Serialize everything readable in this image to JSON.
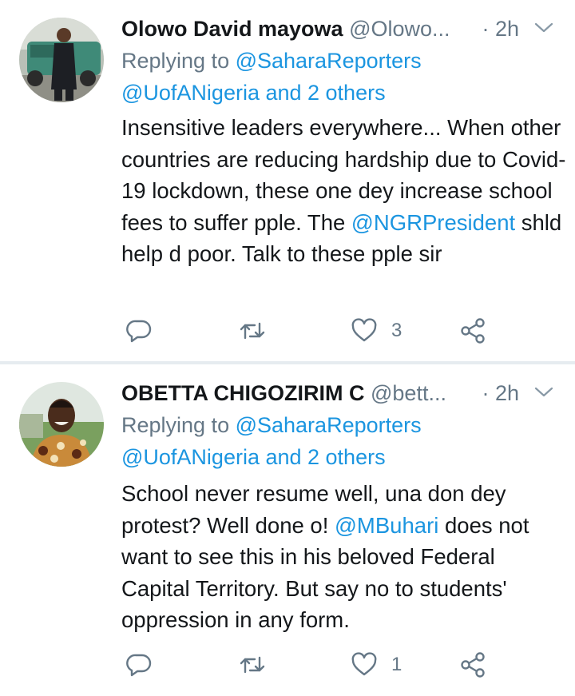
{
  "tweets": [
    {
      "name": "Olowo David mayowa",
      "handle": "@Olowo...",
      "time": "· 2h",
      "replying_prefix": "Replying to ",
      "replying_to": "@SaharaReporters",
      "replying_line2": "@UofANigeria and 2 others",
      "body_parts": [
        "Insensitive leaders everywhere... When other countries are reducing hardship due to Covid-19 lockdown, these one dey increase school fees to suffer pple. The ",
        "@NGRPresident",
        " shld help d poor. Talk to these pple sir"
      ],
      "likes": "3"
    },
    {
      "name": "OBETTA CHIGOZIRIM C",
      "handle": "@bett...",
      "time": "· 2h",
      "replying_prefix": "Replying to ",
      "replying_to": "@SaharaReporters",
      "replying_line2": "@UofANigeria and 2 others",
      "body_parts": [
        "School never resume well, una don dey protest? Well done o! ",
        "@MBuhari",
        " does not want to see this in his beloved Federal Capital Territory. But say no to students' oppression in any form."
      ],
      "likes": "1"
    }
  ],
  "icons": {
    "reply": "reply-icon",
    "retweet": "retweet-icon",
    "like": "heart-icon",
    "share": "share-icon",
    "menu": "chevron-down-icon"
  },
  "colors": {
    "text": "#14171a",
    "muted": "#657786",
    "link": "#1b95e0",
    "divider": "#e6ecf0"
  }
}
